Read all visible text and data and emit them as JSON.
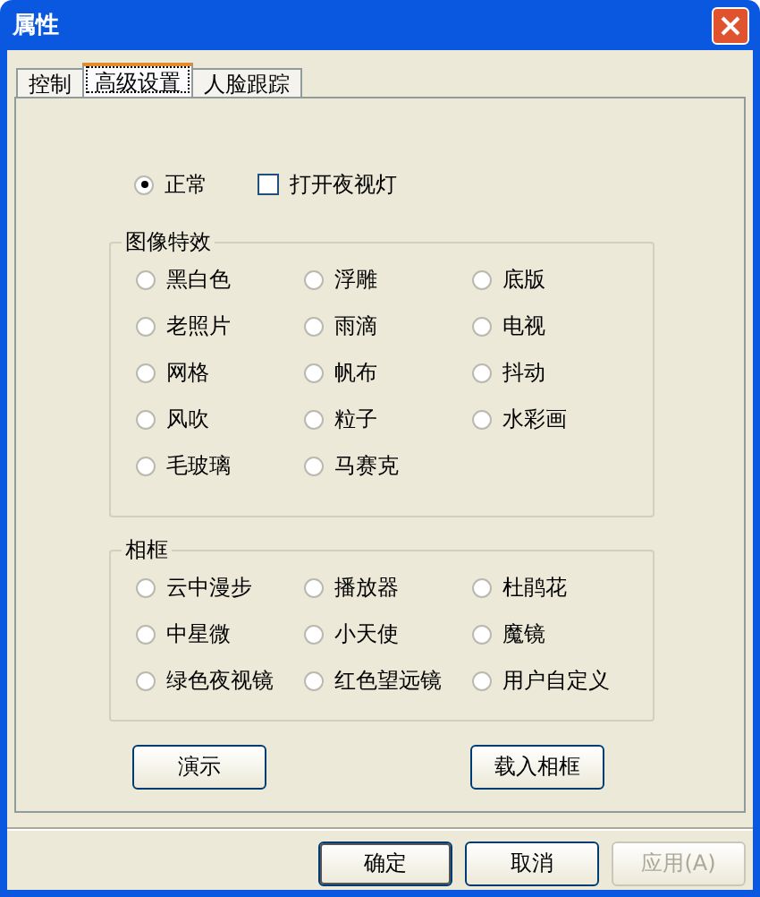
{
  "window": {
    "title": "属性"
  },
  "tabs": [
    {
      "label": "控制",
      "selected": false
    },
    {
      "label": "高级设置",
      "selected": true
    },
    {
      "label": "人脸跟踪",
      "selected": false
    }
  ],
  "mode": {
    "normal": {
      "label": "正常",
      "selected": true
    },
    "night_light": {
      "label": "打开夜视灯",
      "checked": false
    }
  },
  "effects": {
    "title": "图像特效",
    "options": [
      {
        "label": "黑白色",
        "selected": false
      },
      {
        "label": "浮雕",
        "selected": false
      },
      {
        "label": "底版",
        "selected": false
      },
      {
        "label": "老照片",
        "selected": false
      },
      {
        "label": "雨滴",
        "selected": false
      },
      {
        "label": "电视",
        "selected": false
      },
      {
        "label": "网格",
        "selected": false
      },
      {
        "label": "帆布",
        "selected": false
      },
      {
        "label": "抖动",
        "selected": false
      },
      {
        "label": "风吹",
        "selected": false
      },
      {
        "label": "粒子",
        "selected": false
      },
      {
        "label": "水彩画",
        "selected": false
      },
      {
        "label": "毛玻璃",
        "selected": false
      },
      {
        "label": "马赛克",
        "selected": false
      }
    ]
  },
  "frames": {
    "title": "相框",
    "options": [
      {
        "label": "云中漫步",
        "selected": false
      },
      {
        "label": "播放器",
        "selected": false
      },
      {
        "label": "杜鹃花",
        "selected": false
      },
      {
        "label": "中星微",
        "selected": false
      },
      {
        "label": "小天使",
        "selected": false
      },
      {
        "label": "魔镜",
        "selected": false
      },
      {
        "label": "绿色夜视镜",
        "selected": false
      },
      {
        "label": "红色望远镜",
        "selected": false
      },
      {
        "label": "用户自定义",
        "selected": false
      }
    ]
  },
  "buttons": [
    {
      "label": "演示"
    },
    {
      "label": "载入相框"
    }
  ],
  "footer_buttons": [
    {
      "label": "确定",
      "default": true,
      "disabled": false
    },
    {
      "label": "取消",
      "default": false,
      "disabled": false
    },
    {
      "label": "应用(A)",
      "default": false,
      "disabled": true
    }
  ]
}
